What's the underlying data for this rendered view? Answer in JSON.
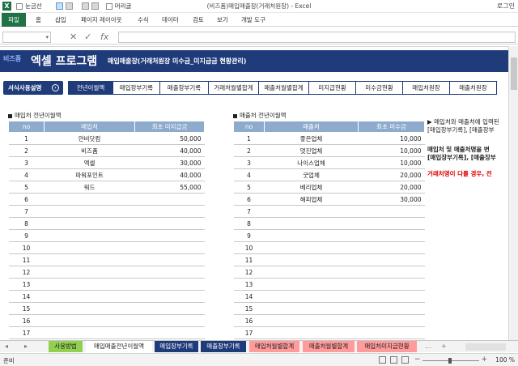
{
  "window": {
    "app_letter": "X",
    "title": "(비즈폼)매입매출장(거래처원장) - Excel",
    "login": "로그인",
    "qat": {
      "gridlines_label": "눈금선",
      "header_label": "머리글"
    }
  },
  "ribbon": {
    "tabs": [
      "파일",
      "홈",
      "삽입",
      "페이지 레이아웃",
      "수식",
      "데이터",
      "검토",
      "보기",
      "개발 도구"
    ]
  },
  "formula_bar": {
    "name_box": "",
    "cancel": "✕",
    "enter": "✓",
    "fx": "fx",
    "value": ""
  },
  "banner": {
    "brand": "비즈폼",
    "title": "엑셀 프로그램",
    "subtitle": "매입매출장(거래처원장 미수금_미지급금 현황관리)"
  },
  "nav": {
    "howto": "서식사용설명",
    "howto_icon": "›",
    "tabs": [
      {
        "label": "전년이월액",
        "active": true
      },
      {
        "label": "매입장부기록",
        "active": false
      },
      {
        "label": "매출장부기록",
        "active": false
      },
      {
        "label": "거래처월별합계",
        "active": false
      },
      {
        "label": "매출처월별합계",
        "active": false
      },
      {
        "label": "미지급현황",
        "active": false
      },
      {
        "label": "미수금현황",
        "active": false
      },
      {
        "label": "매입처원장",
        "active": false
      },
      {
        "label": "매출처원장",
        "active": false
      }
    ]
  },
  "purchase_table": {
    "section_title": "매입처 전년이월액",
    "headers": [
      "no",
      "매입처",
      "최초 미지급금"
    ],
    "rows": [
      [
        "1",
        "안비닷컴",
        "50,000"
      ],
      [
        "2",
        "비즈폼",
        "40,000"
      ],
      [
        "3",
        "엑셀",
        "30,000"
      ],
      [
        "4",
        "파워포인트",
        "40,000"
      ],
      [
        "5",
        "워드",
        "55,000"
      ],
      [
        "6",
        "",
        ""
      ],
      [
        "7",
        "",
        ""
      ],
      [
        "8",
        "",
        ""
      ],
      [
        "9",
        "",
        ""
      ],
      [
        "10",
        "",
        ""
      ],
      [
        "11",
        "",
        ""
      ],
      [
        "12",
        "",
        ""
      ],
      [
        "13",
        "",
        ""
      ],
      [
        "14",
        "",
        ""
      ],
      [
        "15",
        "",
        ""
      ],
      [
        "16",
        "",
        ""
      ],
      [
        "17",
        "",
        ""
      ]
    ]
  },
  "sales_table": {
    "section_title": "매출처 전년이월액",
    "headers": [
      "no",
      "매출처",
      "최초 미수금"
    ],
    "rows": [
      [
        "1",
        "좋은업체",
        "10,000"
      ],
      [
        "2",
        "멋진업체",
        "10,000"
      ],
      [
        "3",
        "나이스업체",
        "10,000"
      ],
      [
        "4",
        "굿업체",
        "20,000"
      ],
      [
        "5",
        "베리업체",
        "20,000"
      ],
      [
        "6",
        "해피업체",
        "30,000"
      ],
      [
        "7",
        "",
        ""
      ],
      [
        "8",
        "",
        ""
      ],
      [
        "9",
        "",
        ""
      ],
      [
        "10",
        "",
        ""
      ],
      [
        "11",
        "",
        ""
      ],
      [
        "12",
        "",
        ""
      ],
      [
        "13",
        "",
        ""
      ],
      [
        "14",
        "",
        ""
      ],
      [
        "15",
        "",
        ""
      ],
      [
        "16",
        "",
        ""
      ],
      [
        "17",
        "",
        ""
      ]
    ]
  },
  "notes": {
    "line1a": "▶ 매입처와 매출처에 입력된",
    "line1b": "[매입장부기록], [매출장부",
    "line2a": "매입처 및 매출처명을 변",
    "line2b": "[매입장부기록], [매출장부",
    "line3": "거래처명이 다를 경우, 전"
  },
  "sheet_tabs": [
    {
      "label": "사용방법",
      "bg": "#92d050",
      "fg": "#222"
    },
    {
      "label": "매입매출전년이월액",
      "bg": "#ffffff",
      "fg": "#222"
    },
    {
      "label": "매입장부기록",
      "bg": "#1f3b7a",
      "fg": "#ffffff"
    },
    {
      "label": "매출장부기록",
      "bg": "#1f3b7a",
      "fg": "#ffffff"
    },
    {
      "label": "매입처월별합계",
      "bg": "#ff9b9b",
      "fg": "#222"
    },
    {
      "label": "매출처월별합계",
      "bg": "#ff9b9b",
      "fg": "#222"
    },
    {
      "label": "매입처미지급현황",
      "bg": "#ff9b9b",
      "fg": "#222"
    }
  ],
  "sheet_tab_more": "...",
  "sheet_tab_add": "+",
  "status": {
    "ready": "준비",
    "zoom": "100 %"
  },
  "colors": {
    "navy": "#1f3b7a",
    "header_blue": "#8eaacc",
    "excel_green": "#217346"
  }
}
